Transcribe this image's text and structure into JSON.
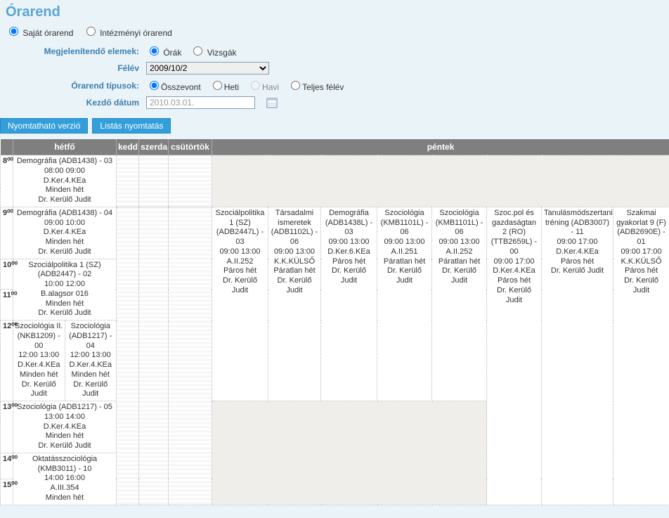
{
  "title": "Órarend",
  "view_mode": {
    "own_label": "Saját órarend",
    "inst_label": "Intézményi órarend"
  },
  "labels": {
    "display_elements": "Megjelenítendő elemek:",
    "semester": "Félév",
    "schedule_types": "Órarend típusok:",
    "start_date": "Kezdő dátum"
  },
  "elements": {
    "classes": "Órák",
    "exams": "Vizsgák"
  },
  "semester_value": "2009/10/2",
  "types": {
    "aggregate": "Összevont",
    "weekly": "Heti",
    "monthly": "Havi",
    "full": "Teljes félév"
  },
  "start_date_value": "2010.03.01.",
  "buttons": {
    "print": "Nyomtatható verzió",
    "listprint": "Listás nyomtatás"
  },
  "days": {
    "mon": "hétfő",
    "tue": "kedd",
    "wed": "szerda",
    "thu": "csütörtök",
    "fri": "péntek"
  },
  "hours": [
    "8⁰⁰",
    "9⁰⁰",
    "10⁰⁰",
    "11⁰⁰",
    "12⁰⁰",
    "13⁰⁰",
    "14⁰⁰",
    "15⁰⁰"
  ],
  "mon": {
    "h8": "Demográfia (ADB1438) - 03\n08:00 09:00\nD.Ker.4.KEa\nMinden hét\nDr. Kerülő Judit",
    "h9": "Demográfia (ADB1438) - 04\n09:00 10:00\nD.Ker.4.KEa\nMinden hét\nDr. Kerülő Judit",
    "h10": "Szociálpolitika 1 (SZ) (ADB2447) - 02\n10:00 12:00\nB.alagsor 016\nMinden hét\nDr. Kerülő Judit",
    "h12a": "Szociológia II. (NKB1209) - 00\n12:00 13:00\nD.Ker.4.KEa\nMinden hét\nDr. Kerülő Judit",
    "h12b": "Szociológia (ADB1217) - 04\n12:00 13:00\nD.Ker.4.KEa\nMinden hét\nDr. Kerülő Judit",
    "h13": "Szociológia (ADB1217) - 05\n13:00 14:00\nD.Ker.4.KEa\nMinden hét\nDr. Kerülő Judit",
    "h14": "Oktatásszociológia (KMB3011) - 10\n14:00 16:00\nA.III.354\nMinden hét"
  },
  "fri": {
    "c1": "Szociálpolitika 1 (SZ) (ADB2447L) - 03\n09:00 13:00\nA.II.252\nPáros hét\nDr. Kerülő Judit",
    "c2": "Társadalmi ismeretek (ADB1102L) - 06\n09:00 13:00\nK.K.KÜLSŐ\nPáratlan hét\nDr. Kerülő Judit",
    "c3": "Demográfia (ADB1438L) - 03\n09:00 13:00\nD.Ker.6.KEa\nPáros hét\nDr. Kerülő Judit",
    "c4": "Szociológia (KMB1101L) - 06\n09:00 13:00\nA.II.251\nPáratlan hét\nDr. Kerülő Judit",
    "c5": "Szociológia (KMB1101L) - 06\n09:00 13:00\nA.II.252\nPáratlan hét\nDr. Kerülő Judit",
    "c6": "Szoc.pol és gazdaságtan 2 (RO) (TTB2659L) - 00\n09:00 17:00\nD.Ker.4.KEa\nPáros hét\nDr. Kerülő Judit",
    "c7": "Tanulásmódszertani tréning (ADB3007) - 11\n09:00 17:00\nD.Ker.4.KEa\nPáros hét\nDr. Kerülő Judit",
    "c8": "Szakmai gyakorlat 9 (F) (ADB2690E) - 01\n09:00 17:00\nK.K.KÜLSŐ\nPáros hét\nDr. Kerülő Judit"
  }
}
